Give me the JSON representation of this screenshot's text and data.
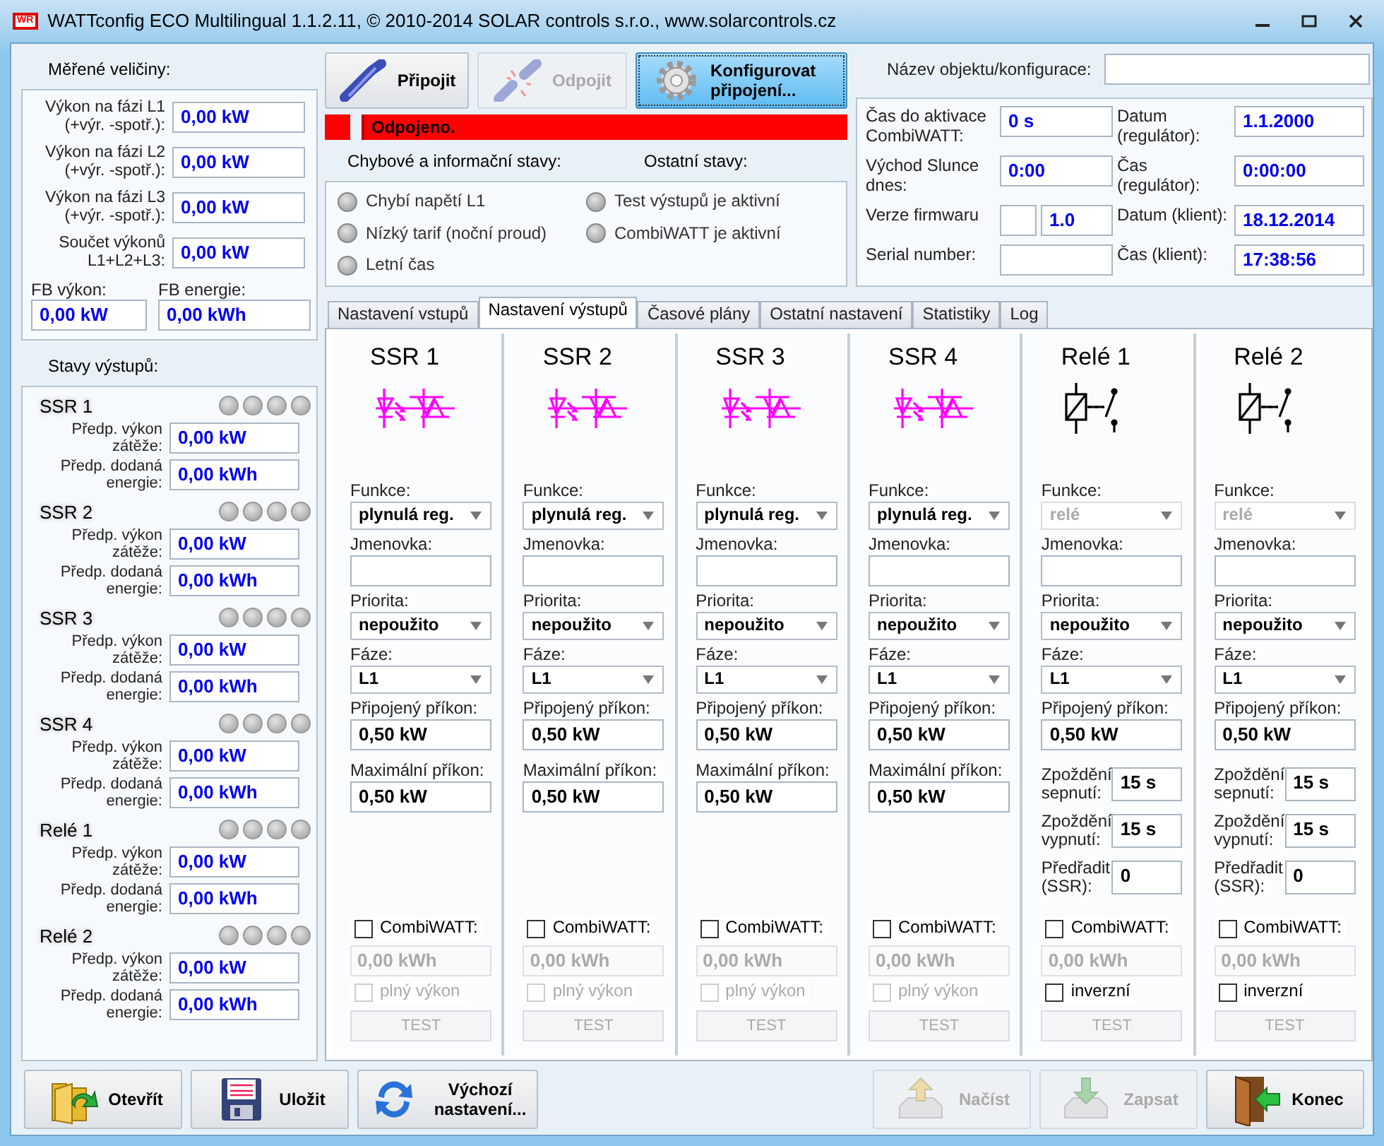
{
  "window": {
    "logo": "WR",
    "title": "WATTconfig ECO Multilingual 1.1.2.11, © 2010-2014 SOLAR controls s.r.o., www.solarcontrols.cz"
  },
  "measured": {
    "title": "Měřené veličiny:",
    "rows": [
      {
        "label": "Výkon na fázi L1 (+výr. -spotř.):",
        "value": "0,00 kW"
      },
      {
        "label": "Výkon na fázi L2 (+výr. -spotř.):",
        "value": "0,00 kW"
      },
      {
        "label": "Výkon na fázi L3 (+výr. -spotř.):",
        "value": "0,00 kW"
      },
      {
        "label": "Součet výkonů L1+L2+L3:",
        "value": "0,00 kW"
      }
    ],
    "fb": [
      {
        "label": "FB výkon:",
        "value": "0,00 kW"
      },
      {
        "label": "FB energie:",
        "value": "0,00 kWh"
      }
    ]
  },
  "output_states": {
    "title": "Stavy výstupů:",
    "outputs": [
      {
        "name": "SSR 1",
        "leds": [
          {
            "on": false
          },
          {
            "on": false
          },
          {
            "on": false
          },
          {
            "on": false
          }
        ],
        "load_label": "Předp. výkon zátěže:",
        "load": "0,00 kW",
        "energy_label": "Předp. dodaná energie:",
        "energy": "0,00 kWh"
      },
      {
        "name": "SSR 2",
        "leds": [
          {
            "on": false
          },
          {
            "on": false
          },
          {
            "on": false
          },
          {
            "on": false
          }
        ],
        "load_label": "Předp. výkon zátěže:",
        "load": "0,00 kW",
        "energy_label": "Předp. dodaná energie:",
        "energy": "0,00 kWh"
      },
      {
        "name": "SSR 3",
        "leds": [
          {
            "on": false
          },
          {
            "on": false
          },
          {
            "on": false
          },
          {
            "on": false
          }
        ],
        "load_label": "Předp. výkon zátěže:",
        "load": "0,00 kW",
        "energy_label": "Předp. dodaná energie:",
        "energy": "0,00 kWh"
      },
      {
        "name": "SSR 4",
        "leds": [
          {
            "on": false
          },
          {
            "on": false
          },
          {
            "on": false
          },
          {
            "on": false
          }
        ],
        "load_label": "Předp. výkon zátěže:",
        "load": "0,00 kW",
        "energy_label": "Předp. dodaná energie:",
        "energy": "0,00 kWh"
      },
      {
        "name": "Relé 1",
        "leds": [
          {
            "on": false
          },
          {
            "on": false
          },
          {
            "on": false
          },
          {
            "on": false
          }
        ],
        "load_label": "Předp. výkon zátěže:",
        "load": "0,00 kW",
        "energy_label": "Předp. dodaná energie:",
        "energy": "0,00 kWh"
      },
      {
        "name": "Relé 2",
        "leds": [
          {
            "on": false
          },
          {
            "on": false
          },
          {
            "on": false
          },
          {
            "on": false
          }
        ],
        "load_label": "Předp. výkon zátěže:",
        "load": "0,00 kW",
        "energy_label": "Předp. dodaná energie:",
        "energy": "0,00 kWh"
      }
    ]
  },
  "connection": {
    "buttons": [
      {
        "label": "Připojit",
        "disabled": false,
        "highlighted": false
      },
      {
        "label": "Odpojit",
        "disabled": true,
        "highlighted": false
      },
      {
        "label": "Konfigurovat připojení...",
        "disabled": false,
        "highlighted": true
      }
    ],
    "connected": false,
    "status": "Odpojeno."
  },
  "status_flags": {
    "error_title": "Chybové a informační stavy:",
    "other_title": "Ostatní stavy:",
    "error_items": [
      {
        "label": "Chybí napětí L1",
        "on": false
      },
      {
        "label": "Nízký tarif (noční proud)",
        "on": false
      },
      {
        "label": "Letní čas",
        "on": false
      }
    ],
    "other_items": [
      {
        "label": "Test výstupů je aktivní",
        "on": false
      },
      {
        "label": "CombiWATT je aktivní",
        "on": false
      }
    ]
  },
  "info": {
    "name_label": "Název objektu/konfigurace:",
    "fields": [
      {
        "kind": "value",
        "label": "Čas do aktivace CombiWATT:",
        "value": "0 s"
      },
      {
        "kind": "value",
        "label": "Datum (regulátor):",
        "value": "1.1.2000"
      },
      {
        "kind": "value",
        "label": "Východ Slunce dnes:",
        "value": "0:00"
      },
      {
        "kind": "value",
        "label": "Čas (regulátor):",
        "value": "0:00:00"
      },
      {
        "kind": "pair",
        "label": "Verze firmwaru",
        "value": "1.0"
      },
      {
        "kind": "value",
        "label": "Datum (klient):",
        "value": "18.12.2014"
      },
      {
        "kind": "value",
        "label": "Serial number:"
      },
      {
        "kind": "value",
        "label": "Čas (klient):",
        "value": "17:38:56"
      }
    ]
  },
  "tabs": [
    {
      "label": "Nastavení vstupů",
      "selected": false
    },
    {
      "label": "Nastavení výstupů",
      "selected": true
    },
    {
      "label": "Časové plány",
      "selected": false
    },
    {
      "label": "Ostatní nastavení",
      "selected": false
    },
    {
      "label": "Statistiky",
      "selected": false
    },
    {
      "label": "Log",
      "selected": false
    }
  ],
  "output_settings": [
    {
      "name": "SSR 1",
      "kind": "ssr",
      "fields": [
        {
          "kind": "select",
          "label": "Funkce:",
          "value": "plynulá reg.",
          "disabled": false
        },
        {
          "kind": "text",
          "label": "Jmenovka:"
        },
        {
          "kind": "select",
          "label": "Priorita:",
          "value": "nepoužito",
          "disabled": false
        },
        {
          "kind": "select",
          "label": "Fáze:",
          "value": "L1",
          "disabled": false
        },
        {
          "kind": "text",
          "label": "Připojený příkon:",
          "value": "0,50 kW"
        },
        {
          "kind": "text",
          "label": "Maximální příkon:",
          "value": "0,50 kW"
        }
      ],
      "combiwatt": {
        "label": "CombiWATT:",
        "checked": false,
        "energy": "0,00 kWh"
      },
      "option": {
        "label": "plný výkon",
        "checked": false,
        "disabled": true
      },
      "test": {
        "label": "TEST",
        "disabled": true
      }
    },
    {
      "name": "SSR 2",
      "kind": "ssr",
      "fields": [
        {
          "kind": "select",
          "label": "Funkce:",
          "value": "plynulá reg.",
          "disabled": false
        },
        {
          "kind": "text",
          "label": "Jmenovka:"
        },
        {
          "kind": "select",
          "label": "Priorita:",
          "value": "nepoužito",
          "disabled": false
        },
        {
          "kind": "select",
          "label": "Fáze:",
          "value": "L1",
          "disabled": false
        },
        {
          "kind": "text",
          "label": "Připojený příkon:",
          "value": "0,50 kW"
        },
        {
          "kind": "text",
          "label": "Maximální příkon:",
          "value": "0,50 kW"
        }
      ],
      "combiwatt": {
        "label": "CombiWATT:",
        "checked": false,
        "energy": "0,00 kWh"
      },
      "option": {
        "label": "plný výkon",
        "checked": false,
        "disabled": true
      },
      "test": {
        "label": "TEST",
        "disabled": true
      }
    },
    {
      "name": "SSR 3",
      "kind": "ssr",
      "fields": [
        {
          "kind": "select",
          "label": "Funkce:",
          "value": "plynulá reg.",
          "disabled": false
        },
        {
          "kind": "text",
          "label": "Jmenovka:"
        },
        {
          "kind": "select",
          "label": "Priorita:",
          "value": "nepoužito",
          "disabled": false
        },
        {
          "kind": "select",
          "label": "Fáze:",
          "value": "L1",
          "disabled": false
        },
        {
          "kind": "text",
          "label": "Připojený příkon:",
          "value": "0,50 kW"
        },
        {
          "kind": "text",
          "label": "Maximální příkon:",
          "value": "0,50 kW"
        }
      ],
      "combiwatt": {
        "label": "CombiWATT:",
        "checked": false,
        "energy": "0,00 kWh"
      },
      "option": {
        "label": "plný výkon",
        "checked": false,
        "disabled": true
      },
      "test": {
        "label": "TEST",
        "disabled": true
      }
    },
    {
      "name": "SSR 4",
      "kind": "ssr",
      "fields": [
        {
          "kind": "select",
          "label": "Funkce:",
          "value": "plynulá reg.",
          "disabled": false
        },
        {
          "kind": "text",
          "label": "Jmenovka:"
        },
        {
          "kind": "select",
          "label": "Priorita:",
          "value": "nepoužito",
          "disabled": false
        },
        {
          "kind": "select",
          "label": "Fáze:",
          "value": "L1",
          "disabled": false
        },
        {
          "kind": "text",
          "label": "Připojený příkon:",
          "value": "0,50 kW"
        },
        {
          "kind": "text",
          "label": "Maximální příkon:",
          "value": "0,50 kW"
        }
      ],
      "combiwatt": {
        "label": "CombiWATT:",
        "checked": false,
        "energy": "0,00 kWh"
      },
      "option": {
        "label": "plný výkon",
        "checked": false,
        "disabled": true
      },
      "test": {
        "label": "TEST",
        "disabled": true
      }
    },
    {
      "name": "Relé 1",
      "kind": "relay",
      "fields": [
        {
          "kind": "select",
          "label": "Funkce:",
          "value": "relé",
          "disabled": true
        },
        {
          "kind": "text",
          "label": "Jmenovka:"
        },
        {
          "kind": "select",
          "label": "Priorita:",
          "value": "nepoužito",
          "disabled": false
        },
        {
          "kind": "select",
          "label": "Fáze:",
          "value": "L1",
          "disabled": false
        },
        {
          "kind": "text",
          "label": "Připojený příkon:",
          "value": "0,50 kW"
        },
        {
          "kind": "inline",
          "label": "Zpoždění sepnutí:",
          "value": "15 s"
        },
        {
          "kind": "inline",
          "label": "Zpoždění vypnutí:",
          "value": "15 s"
        },
        {
          "kind": "inline",
          "label": "Předřadit (SSR):",
          "value": "0"
        }
      ],
      "combiwatt": {
        "label": "CombiWATT:",
        "checked": false,
        "energy": "0,00 kWh"
      },
      "option": {
        "label": "inverzní",
        "checked": false,
        "disabled": false
      },
      "test": {
        "label": "TEST",
        "disabled": true
      }
    },
    {
      "name": "Relé 2",
      "kind": "relay",
      "fields": [
        {
          "kind": "select",
          "label": "Funkce:",
          "value": "relé",
          "disabled": true
        },
        {
          "kind": "text",
          "label": "Jmenovka:"
        },
        {
          "kind": "select",
          "label": "Priorita:",
          "value": "nepoužito",
          "disabled": false
        },
        {
          "kind": "select",
          "label": "Fáze:",
          "value": "L1",
          "disabled": false
        },
        {
          "kind": "text",
          "label": "Připojený příkon:",
          "value": "0,50 kW"
        },
        {
          "kind": "inline",
          "label": "Zpoždění sepnutí:",
          "value": "15 s"
        },
        {
          "kind": "inline",
          "label": "Zpoždění vypnutí:",
          "value": "15 s"
        },
        {
          "kind": "inline",
          "label": "Předřadit (SSR):",
          "value": "0"
        }
      ],
      "combiwatt": {
        "label": "CombiWATT:",
        "checked": false,
        "energy": "0,00 kWh"
      },
      "option": {
        "label": "inverzní",
        "checked": false,
        "disabled": false
      },
      "test": {
        "label": "TEST",
        "disabled": true
      }
    }
  ],
  "bottom_buttons": [
    {
      "label": "Otevřít",
      "disabled": false
    },
    {
      "label": "Uložit",
      "disabled": false
    },
    {
      "label": "Výchozí nastavení...",
      "disabled": false
    },
    {
      "label": "Načíst",
      "disabled": true
    },
    {
      "label": "Zapsat",
      "disabled": true
    },
    {
      "label": "Konec",
      "disabled": false
    }
  ]
}
